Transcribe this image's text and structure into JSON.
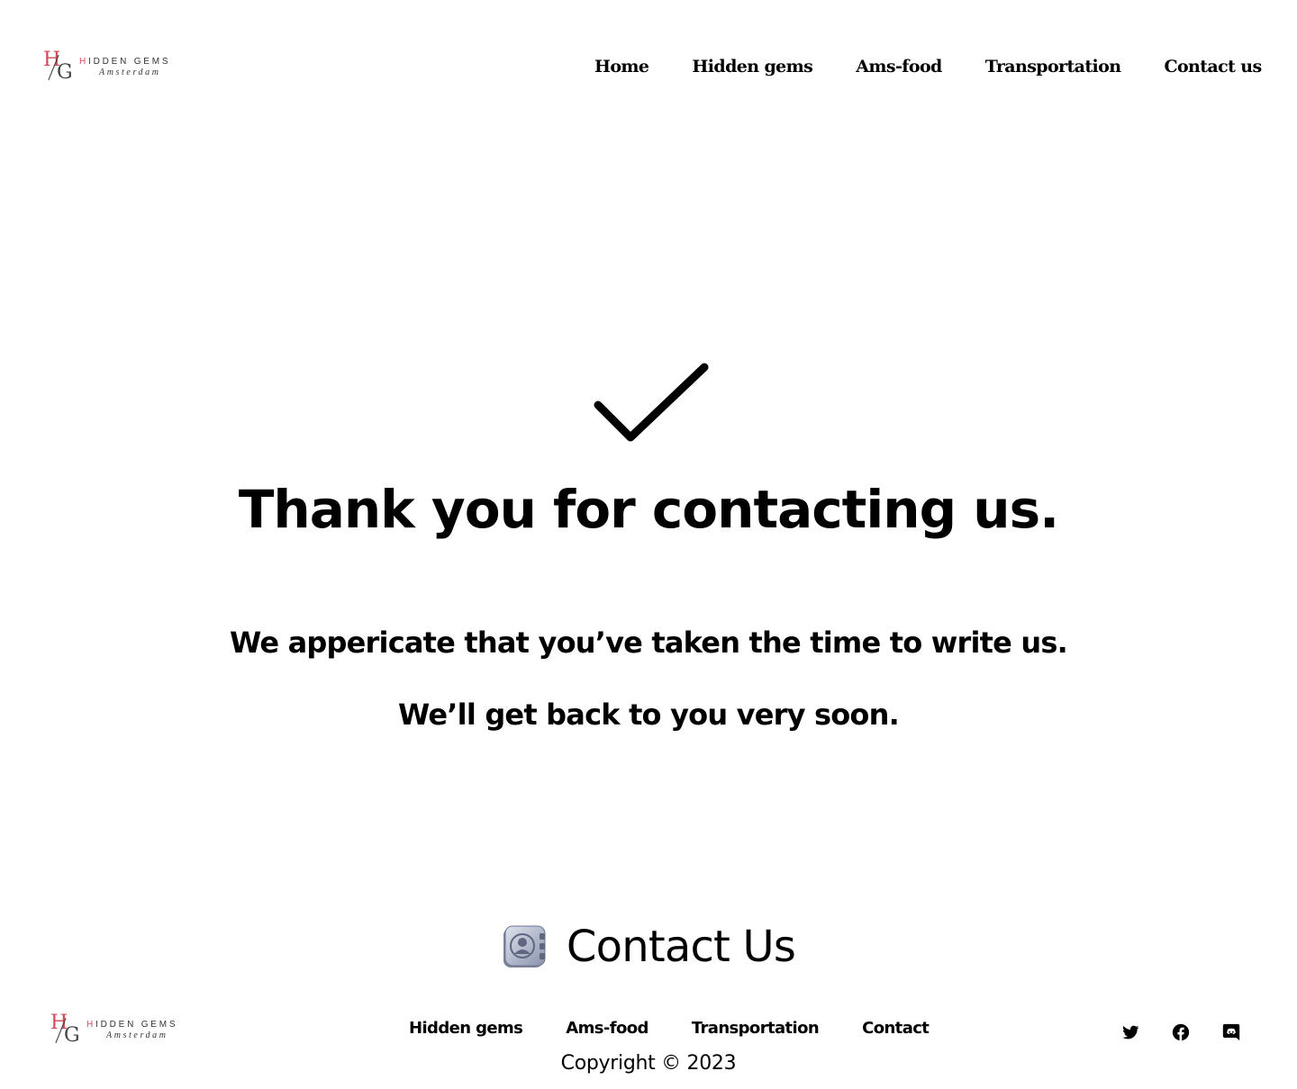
{
  "brand": {
    "mark_letters": [
      "H",
      "G"
    ],
    "name_first_letter": "H",
    "name_rest": "IDDEN GEMS",
    "city": "Amsterdam",
    "accent_color": "#d14a55"
  },
  "header": {
    "nav": [
      "Home",
      "Hidden gems",
      "Ams-food",
      "Transportation",
      "Contact us"
    ]
  },
  "confirmation": {
    "icon": "checkmark-icon",
    "title": "Thank you for contacting us.",
    "line1": "We appericate that you’ve taken the time to write us.",
    "line2": "We’ll get back to you very soon."
  },
  "contact_section": {
    "icon": "contact-book-icon",
    "heading": "Contact Us"
  },
  "footer": {
    "nav": [
      "Hidden gems",
      "Ams-food",
      "Transportation",
      "Contact"
    ],
    "copyright": "Copyright © 2023",
    "social_icons": [
      "twitter-icon",
      "facebook-icon",
      "discord-icon"
    ]
  }
}
